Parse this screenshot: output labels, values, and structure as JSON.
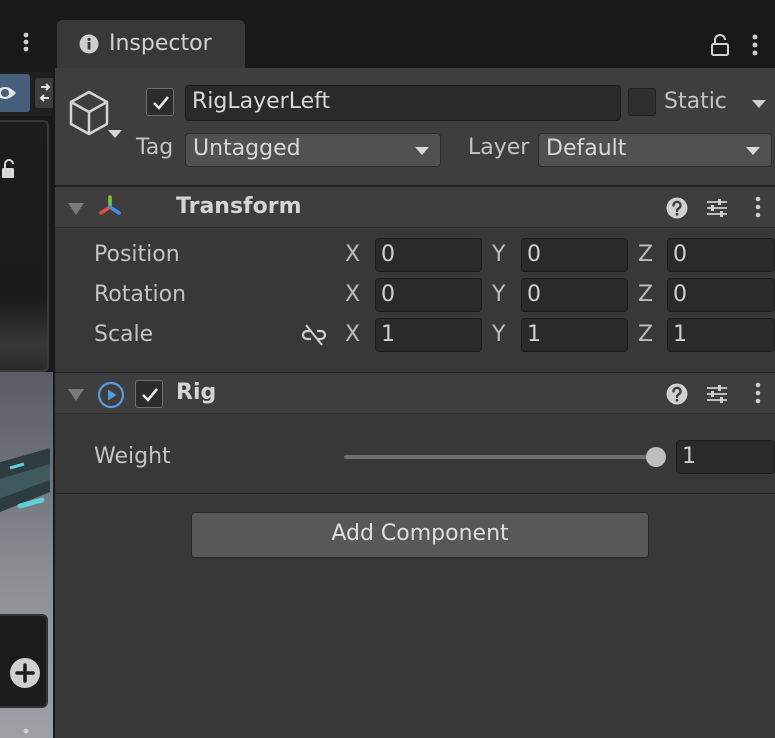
{
  "inspector_tab": {
    "label": "Inspector",
    "icon": "info-icon"
  },
  "header": {
    "name": "RigLayerLeft",
    "active": true,
    "static_label": "Static",
    "static_checked": false,
    "tag_label": "Tag",
    "tag_value": "Untagged",
    "layer_label": "Layer",
    "layer_value": "Default"
  },
  "transform": {
    "title": "Transform",
    "rows": [
      {
        "label": "Position",
        "x": "0",
        "y": "0",
        "z": "0"
      },
      {
        "label": "Rotation",
        "x": "0",
        "y": "0",
        "z": "0"
      },
      {
        "label": "Scale",
        "x": "1",
        "y": "1",
        "z": "1"
      }
    ],
    "axis_labels": {
      "x": "X",
      "y": "Y",
      "z": "Z"
    }
  },
  "rig": {
    "title": "Rig",
    "enabled": true,
    "weight_label": "Weight",
    "weight_value": "1",
    "weight_fraction": 1.0
  },
  "add_component_label": "Add Component",
  "colors": {
    "panel": "#383838",
    "header": "#3e3e3e",
    "field": "#2a2a2a",
    "selected_button": "#46607c",
    "transform_icon": [
      "#e44c3c",
      "#7fc242",
      "#3f8ee8"
    ],
    "rig_icon": "#5a9be0"
  }
}
